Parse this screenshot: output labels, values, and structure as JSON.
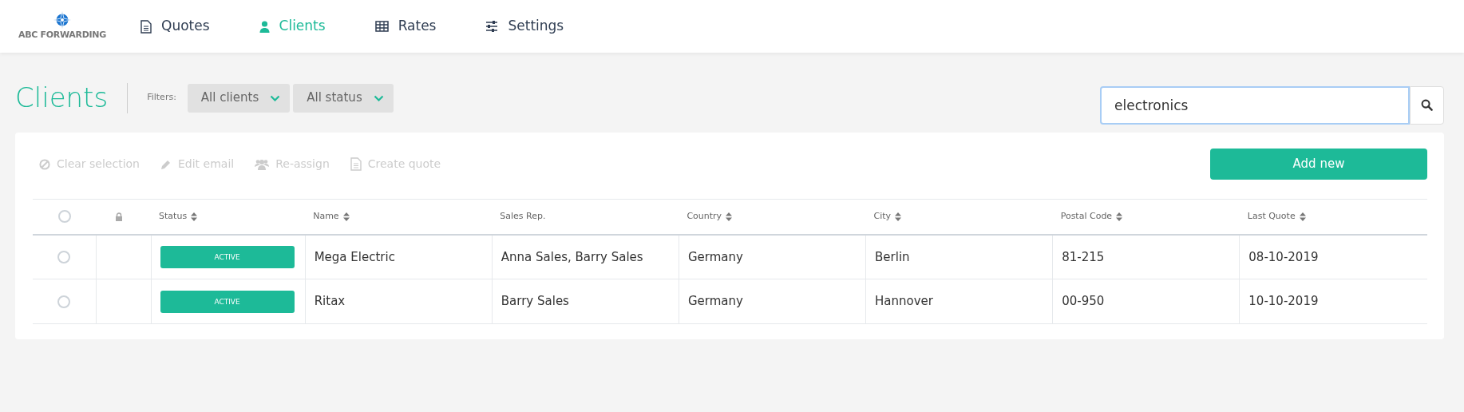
{
  "logo": {
    "text": "ABC FORWARDING"
  },
  "nav": [
    {
      "label": "Quotes",
      "selected": false
    },
    {
      "label": "Clients",
      "selected": true
    },
    {
      "label": "Rates",
      "selected": false
    },
    {
      "label": "Settings",
      "selected": false
    }
  ],
  "page_title": "Clients",
  "filters": {
    "label": "Filters:",
    "dropdowns": [
      "All clients",
      "All status"
    ]
  },
  "search": {
    "value": "electronics"
  },
  "toolbar": [
    {
      "label": "Clear selection",
      "disabled": true
    },
    {
      "label": "Edit email",
      "disabled": true
    },
    {
      "label": "Re-assign",
      "disabled": true
    },
    {
      "label": "Create quote",
      "disabled": true
    }
  ],
  "add_button": "Add new",
  "table": {
    "columns": [
      {
        "kind": "checkbox",
        "selected": false
      },
      {
        "kind": "lock"
      },
      {
        "kind": "text",
        "label": "Status",
        "sortable": true
      },
      {
        "kind": "text",
        "label": "Name",
        "sortable": true
      },
      {
        "kind": "text",
        "label": "Sales Rep.",
        "sortable": false
      },
      {
        "kind": "text",
        "label": "Country",
        "sortable": true
      },
      {
        "kind": "text",
        "label": "City",
        "sortable": true
      },
      {
        "kind": "text",
        "label": "Postal Code",
        "sortable": true
      },
      {
        "kind": "text",
        "label": "Last Quote",
        "sortable": true
      }
    ],
    "rows": [
      {
        "selected": false,
        "status": "ACTIVE",
        "name": "Mega Electric",
        "sales_rep": "Anna Sales, Barry Sales",
        "country": "Germany",
        "city": "Berlin",
        "postal_code": "81-215",
        "last_quote": "08-10-2019"
      },
      {
        "selected": false,
        "status": "ACTIVE",
        "name": "Ritax",
        "sales_rep": "Barry Sales",
        "country": "Germany",
        "city": "Hannover",
        "postal_code": "00-950",
        "last_quote": "10-10-2019"
      }
    ]
  }
}
